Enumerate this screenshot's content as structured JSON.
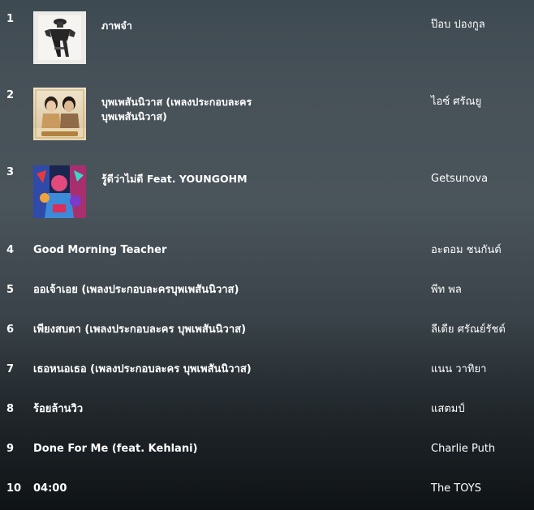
{
  "chart": {
    "entries": [
      {
        "rank": "1",
        "title": "ภาพจำ",
        "artist": "ป๊อบ ปองกูล",
        "cover": "portrait-cover"
      },
      {
        "rank": "2",
        "title": "บุพเพสันนิวาส (เพลงประกอบละคร บุพเพสันนิวาส)",
        "artist": "ไอซ์ ศรัณยู",
        "cover": "drama-couple-cover"
      },
      {
        "rank": "3",
        "title": "รู้ดีว่าไม่ดี Feat. YOUNGOHM",
        "artist": "Getsunova",
        "cover": "colorful-band-cover"
      },
      {
        "rank": "4",
        "title": "Good Morning Teacher",
        "artist": "อะตอม ชนกันต์"
      },
      {
        "rank": "5",
        "title": "ออเจ้าเอย (เพลงประกอบละครบุพเพสันนิวาส)",
        "artist": "พีท พล"
      },
      {
        "rank": "6",
        "title": "เพียงสบตา (เพลงประกอบละคร บุพเพสันนิวาส)",
        "artist": "ลีเดีย ศรัณย์รัชต์"
      },
      {
        "rank": "7",
        "title": "เธอหนอเธอ (เพลงประกอบละคร บุพเพสันนิวาส)",
        "artist": "แนน วาทิยา"
      },
      {
        "rank": "8",
        "title": "ร้อยล้านวิว",
        "artist": "แสตมป์"
      },
      {
        "rank": "9",
        "title": "Done For Me (feat. Kehlani)",
        "artist": "Charlie Puth"
      },
      {
        "rank": "10",
        "title": "04:00",
        "artist": "The TOYS"
      }
    ]
  }
}
